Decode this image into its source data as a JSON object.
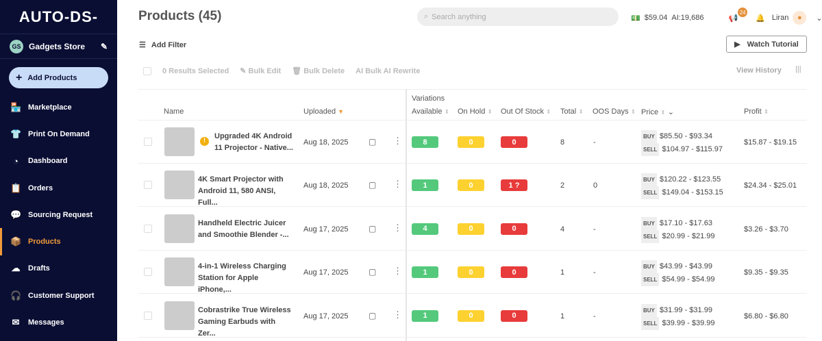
{
  "sidebar": {
    "logo": "AUTO-DS-",
    "store_initials": "GS",
    "store_name": "Gadgets Store",
    "add_products": "Add Products",
    "items": [
      {
        "label": "Marketplace",
        "icon": "store-icon"
      },
      {
        "label": "Print On Demand",
        "icon": "shirt-icon"
      },
      {
        "label": "Dashboard",
        "icon": "gauge-icon"
      },
      {
        "label": "Orders",
        "icon": "clipboard-icon"
      },
      {
        "label": "Sourcing Request",
        "icon": "person-chat-icon"
      },
      {
        "label": "Products",
        "icon": "box-icon",
        "active": true
      },
      {
        "label": "Drafts",
        "icon": "cloud-upload-icon"
      },
      {
        "label": "Customer Support",
        "icon": "headset-icon"
      },
      {
        "label": "Messages",
        "icon": "mail-icon"
      }
    ]
  },
  "header": {
    "title": "Products (45)",
    "search_placeholder": "Search anything",
    "balance": "$59.04",
    "ai": "AI:19,686",
    "notifications": "24",
    "user": "Liran"
  },
  "toolbar": {
    "add_filter": "Add Filter",
    "watch_tutorial": "Watch Tutorial",
    "results_selected": "0 Results Selected",
    "bulk_edit": "Bulk Edit",
    "bulk_delete": "Bulk Delete",
    "bulk_ai": "Bulk AI Rewrite",
    "view_history": "View History"
  },
  "table": {
    "group": "Variations",
    "headers": {
      "name": "Name",
      "uploaded": "Uploaded",
      "available": "Available",
      "on_hold": "On Hold",
      "oos": "Out Of Stock",
      "total": "Total",
      "oos_days": "OOS Days",
      "price": "Price",
      "profit": "Profit"
    },
    "buy": "BUY",
    "sell": "SELL",
    "rows": [
      {
        "name": "Upgraded 4K Android 11 Projector - Native...",
        "warning": true,
        "uploaded": "Aug 18, 2025",
        "available": "8",
        "on_hold": "0",
        "oos": "0",
        "total": "8",
        "oos_days": "-",
        "buy": "$85.50 - $93.34",
        "sell": "$104.97 - $115.97",
        "profit": "$15.87 - $19.15"
      },
      {
        "name": "4K Smart Projector with Android 11, 580 ANSI, Full...",
        "uploaded": "Aug 18, 2025",
        "available": "1",
        "on_hold": "0",
        "oos": "1 ?",
        "total": "2",
        "oos_days": "0",
        "buy": "$120.22 - $123.55",
        "sell": "$149.04 - $153.15",
        "profit": "$24.34 - $25.01"
      },
      {
        "name": "Handheld Electric Juicer and Smoothie Blender -...",
        "uploaded": "Aug 17, 2025",
        "available": "4",
        "on_hold": "0",
        "oos": "0",
        "total": "4",
        "oos_days": "-",
        "buy": "$17.10 - $17.63",
        "sell": "$20.99 - $21.99",
        "profit": "$3.26 - $3.70"
      },
      {
        "name": "4-in-1 Wireless Charging Station for Apple iPhone,...",
        "uploaded": "Aug 17, 2025",
        "available": "1",
        "on_hold": "0",
        "oos": "0",
        "total": "1",
        "oos_days": "-",
        "buy": "$43.99 - $43.99",
        "sell": "$54.99 - $54.99",
        "profit": "$9.35 - $9.35"
      },
      {
        "name": "Cobrastrike True Wireless Gaming Earbuds with Zer...",
        "uploaded": "Aug 17, 2025",
        "available": "1",
        "on_hold": "0",
        "oos": "0",
        "total": "1",
        "oos_days": "-",
        "buy": "$31.99 - $31.99",
        "sell": "$39.99 - $39.99",
        "profit": "$6.80 - $6.80"
      }
    ]
  }
}
